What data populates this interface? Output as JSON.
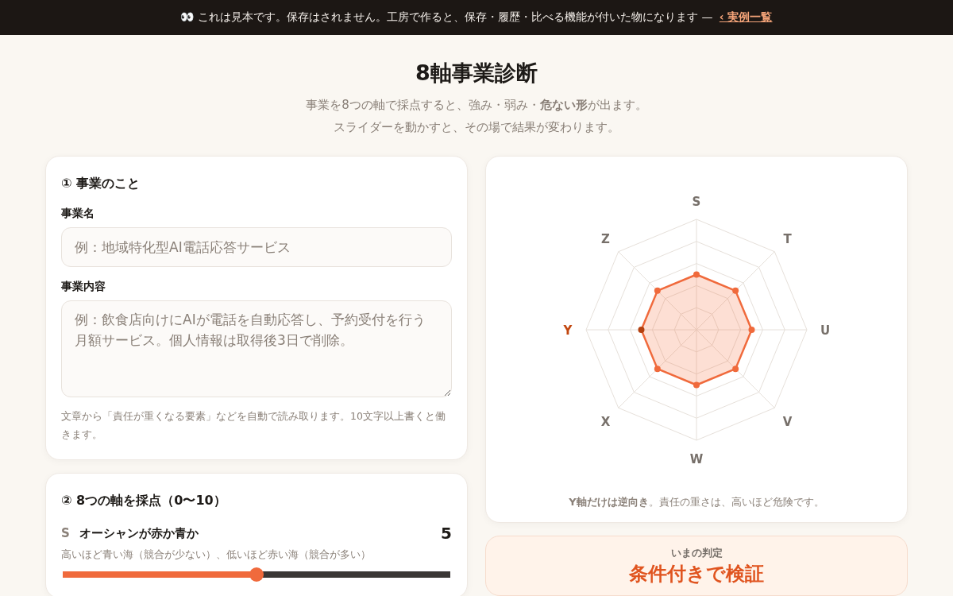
{
  "banner": {
    "icon": "👀",
    "text": "これは見本です。保存はされません。工房で作ると、保存・履歴・比べる機能が付いた物になります —",
    "link": "‹ 実例一覧"
  },
  "header": {
    "title": "8軸事業診断",
    "lines": [
      "事業を8つの軸で採点すると、強み・弱み・**危ない形**が出ます。",
      "スライダーを動かすと、その場で結果が変わります。"
    ]
  },
  "business": {
    "heading": "① 事業のこと",
    "fields": [
      {
        "kind": "input",
        "label": "事業名",
        "placeholder": "例：地域特化型AI電話応答サービス"
      },
      {
        "kind": "textarea",
        "label": "事業内容",
        "placeholder": "例：飲食店向けにAIが電話を自動応答し、予約受付を行う月額サービス。個人情報は取得後3日で削除。"
      }
    ],
    "note": "文章から「責任が重くなる要素」などを自動で読み取ります。10文字以上書くと働きます。"
  },
  "scoring": {
    "heading": "② 8つの軸を採点（0〜10）",
    "axes": [
      {
        "letter": "S",
        "title": "オーシャンが赤か青か",
        "value": "5",
        "hint": "高いほど青い海（競合が少ない）、低いほど赤い海（競合が多い）",
        "level": 0.5
      }
    ]
  },
  "radar": {
    "axes": [
      {
        "label": "S",
        "kind": "normal"
      },
      {
        "label": "T",
        "kind": "normal"
      },
      {
        "label": "U",
        "kind": "normal"
      },
      {
        "label": "V",
        "kind": "normal"
      },
      {
        "label": "W",
        "kind": "normal"
      },
      {
        "label": "X",
        "kind": "normal"
      },
      {
        "label": "Y",
        "kind": "reversed"
      },
      {
        "label": "Z",
        "kind": "normal"
      }
    ],
    "note": "**Y軸だけは逆向き**。責任の重さは、高いほど危険です。"
  },
  "verdict": {
    "label": "いまの判定",
    "result": "条件付きで検証"
  }
}
